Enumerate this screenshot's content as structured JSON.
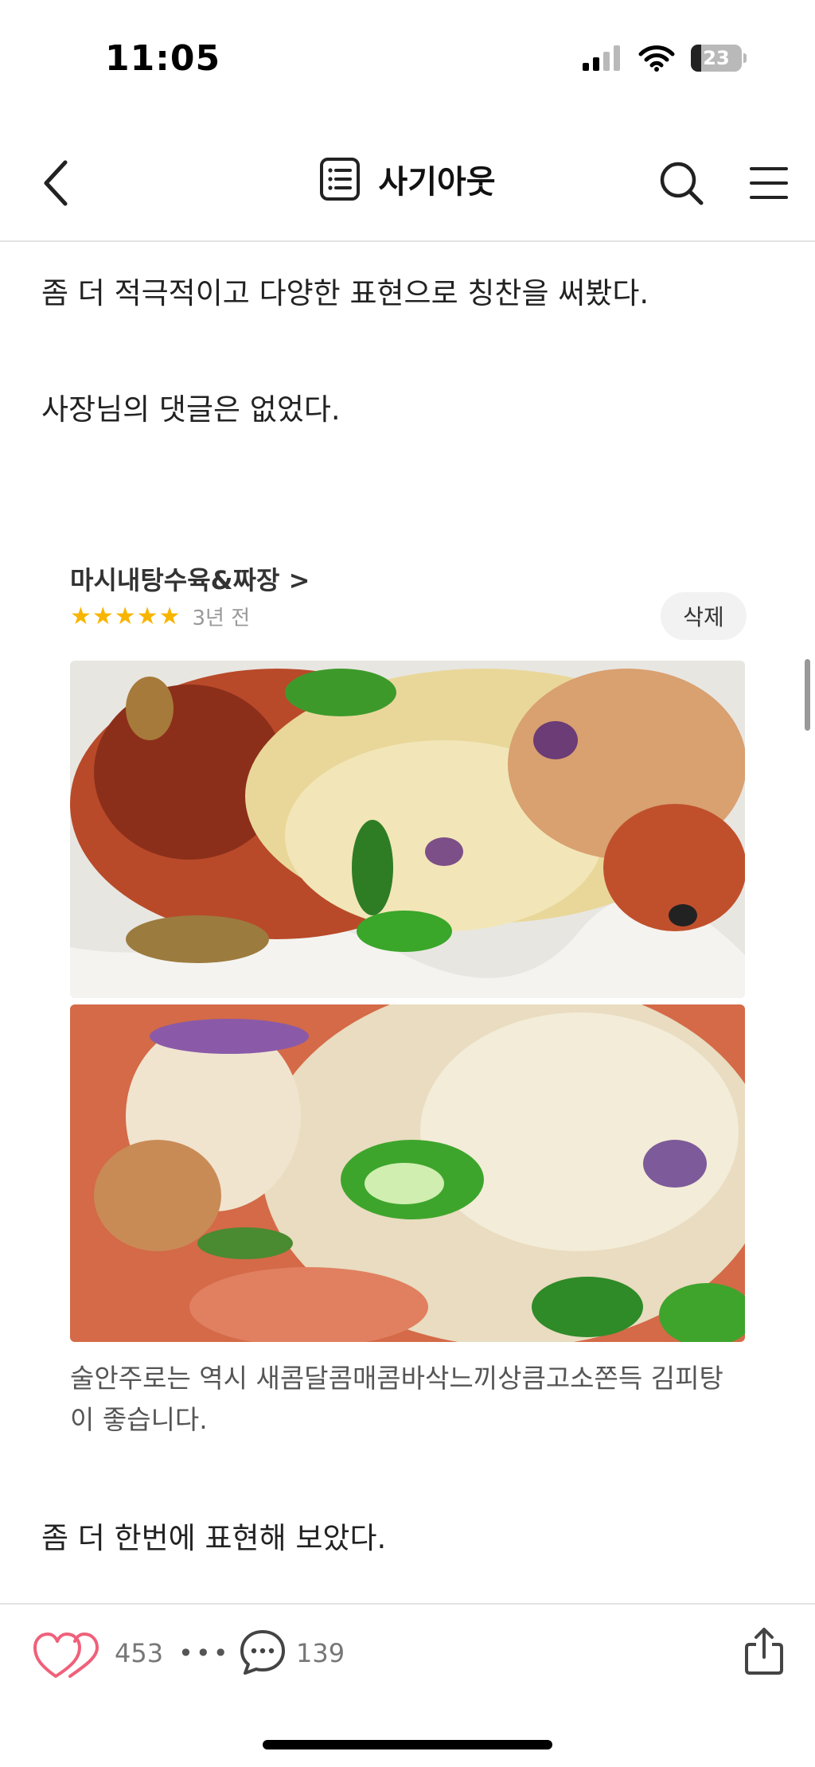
{
  "status_bar": {
    "time": "11:05",
    "battery": "23"
  },
  "nav": {
    "title": "사기아웃"
  },
  "article": {
    "para1": "좀 더 적극적이고 다양한 표현으로 칭찬을 써봤다.",
    "para2": "사장님의 댓글은 없었다.",
    "para3": "좀 더 한번에 표현해 보았다."
  },
  "review": {
    "shop_name": "마시내탕수육&짜장 >",
    "stars": "★★★★★",
    "rating": 5,
    "date": "3년 전",
    "delete_label": "삭제",
    "body": "술안주로는 역시 새콤달콤매콤바삭느끼상큼고소쫀득 김피탕이 좋습니다."
  },
  "bottom_bar": {
    "like_count": "453",
    "more": "•••",
    "comment_count": "139"
  },
  "colors": {
    "star": "#f8b500",
    "like": "#f0607a"
  },
  "icons": {
    "back": "chevron-left-icon",
    "list": "list-icon",
    "search": "search-icon",
    "menu": "hamburger-icon",
    "like": "heart-icon",
    "comment": "comment-icon",
    "share": "share-icon"
  }
}
